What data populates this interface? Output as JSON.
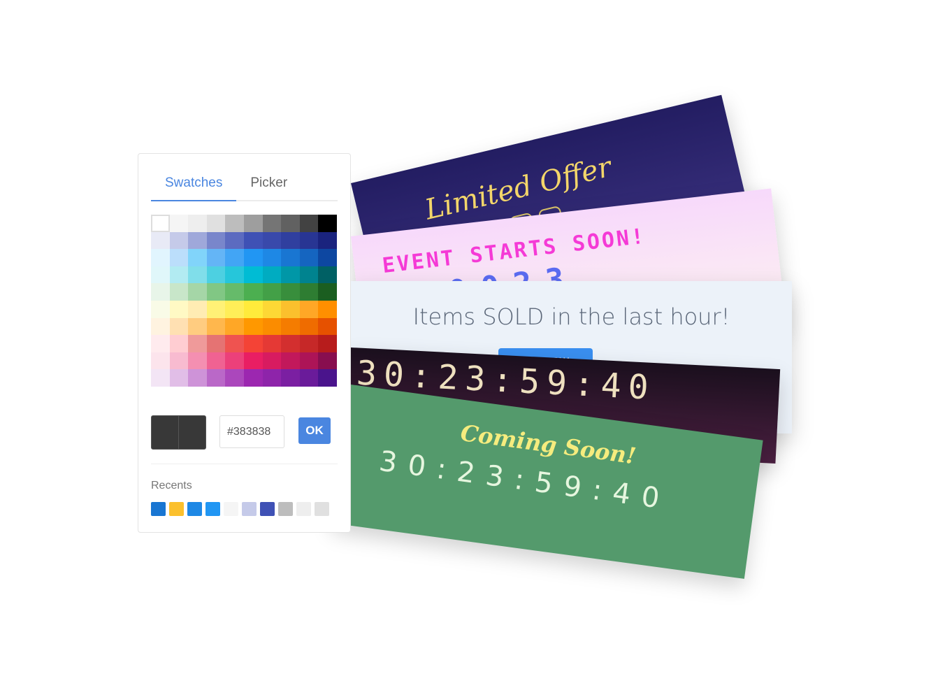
{
  "picker": {
    "tabs": [
      {
        "label": "Swatches",
        "active": true
      },
      {
        "label": "Picker",
        "active": false
      }
    ],
    "swatches": [
      [
        "#ffffff",
        "#f5f5f5",
        "#eeeeee",
        "#e0e0e0",
        "#bdbdbd",
        "#9e9e9e",
        "#757575",
        "#616161",
        "#424242",
        "#000000"
      ],
      [
        "#e8eaf6",
        "#c5cae9",
        "#9fa8da",
        "#7986cb",
        "#5c6bc0",
        "#3f51b5",
        "#3949ab",
        "#303f9f",
        "#283593",
        "#1a237e"
      ],
      [
        "#e1f5fe",
        "#bbdefb",
        "#81d4fa",
        "#64b5f6",
        "#42a5f5",
        "#2196f3",
        "#1e88e5",
        "#1976d2",
        "#1565c0",
        "#0d47a1"
      ],
      [
        "#e0f7fa",
        "#b2ebf2",
        "#80deea",
        "#4dd0e1",
        "#26c6da",
        "#00bcd4",
        "#00acc1",
        "#0097a7",
        "#00838f",
        "#006064"
      ],
      [
        "#e8f5e9",
        "#c8e6c9",
        "#a5d6a7",
        "#81c784",
        "#66bb6a",
        "#4caf50",
        "#43a047",
        "#388e3c",
        "#2e7d32",
        "#1b5e20"
      ],
      [
        "#f9fbe7",
        "#fff9c4",
        "#ffecb3",
        "#fff176",
        "#ffee58",
        "#ffeb3b",
        "#fdd835",
        "#fbc02d",
        "#ffa726",
        "#ff8f00"
      ],
      [
        "#fff3e0",
        "#ffe0b2",
        "#ffcc80",
        "#ffb74d",
        "#ffa726",
        "#ff9800",
        "#fb8c00",
        "#f57c00",
        "#ef6c00",
        "#e65100"
      ],
      [
        "#ffebee",
        "#ffcdd2",
        "#ef9a9a",
        "#e57373",
        "#ef5350",
        "#f44336",
        "#e53935",
        "#d32f2f",
        "#c62828",
        "#b71c1c"
      ],
      [
        "#fce4ec",
        "#f8bbd0",
        "#f48fb1",
        "#f06292",
        "#ec407a",
        "#e91e63",
        "#d81b60",
        "#c2185b",
        "#ad1457",
        "#880e4f"
      ],
      [
        "#f3e5f5",
        "#e1bee7",
        "#ce93d8",
        "#ba68c8",
        "#ab47bc",
        "#9c27b0",
        "#8e24aa",
        "#7b1fa2",
        "#6a1b9a",
        "#4a148c"
      ]
    ],
    "current_color": "#383838",
    "hex_value": "#383838",
    "ok_label": "OK",
    "recents_label": "Recents",
    "recents": [
      "#1976d2",
      "#fbc02d",
      "#1e88e5",
      "#2196f3",
      "#f5f5f5",
      "#c5cae9",
      "#3f51b5",
      "#bdbdbd",
      "#eeeeee",
      "#e0e0e0"
    ]
  },
  "banners": {
    "limited": {
      "title": "Limited Offer",
      "digits": [
        "0",
        "0",
        "2",
        "3"
      ]
    },
    "event": {
      "title": "EVENT STARTS SOON!",
      "digits": "0023"
    },
    "items": {
      "title": "Items SOLD in the last hour!",
      "button": "BUY NOW"
    },
    "dark": {
      "countdown": "30:23:59:40"
    },
    "coming": {
      "title": "Coming Soon!",
      "countdown": "30:23:59:40"
    }
  }
}
